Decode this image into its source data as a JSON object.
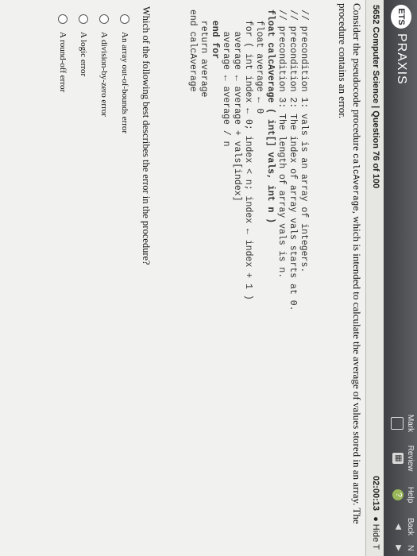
{
  "header": {
    "logo_badge": "ETS",
    "logo_text": "PRAXIS",
    "buttons": [
      {
        "label": "Mark",
        "icon": "checkbox-icon"
      },
      {
        "label": "Review",
        "icon": "review-icon"
      },
      {
        "label": "Help",
        "icon": "help-icon"
      },
      {
        "label": "Back",
        "icon": "back-arrow-icon"
      },
      {
        "label": "N",
        "icon": "next-arrow-icon"
      }
    ]
  },
  "subheader": {
    "section": "5652 Computer Science | Question 76 of 100",
    "timer": "02:00:13",
    "hide_label": "Hide T"
  },
  "question": {
    "intro_before": "Consider the pseudocode procedure ",
    "intro_code": "calcAverage",
    "intro_after": ", which is intended to calculate the average of values stored in an array. The procedure contains an error.",
    "code_lines": [
      "// precondition 1: vals is an array of integers.",
      "// precondition 2: The index of array vals starts at 0.",
      "// precondition 3: The length of array vals is n.",
      "float calcAverage ( int[] vals, int n )",
      "  float average ← 0",
      "  for ( int index ← 0; index < n; index ← index + 1 )",
      "    average ← average + vals[index]",
      "    average ← average / n",
      "  end for",
      "  return average",
      "end calcAverage"
    ],
    "prompt": "Which of the following best describes the error in the procedure?",
    "options": [
      "An array out-of-bounds error",
      "A division-by-zero error",
      "A logic error",
      "A round-off error"
    ]
  }
}
